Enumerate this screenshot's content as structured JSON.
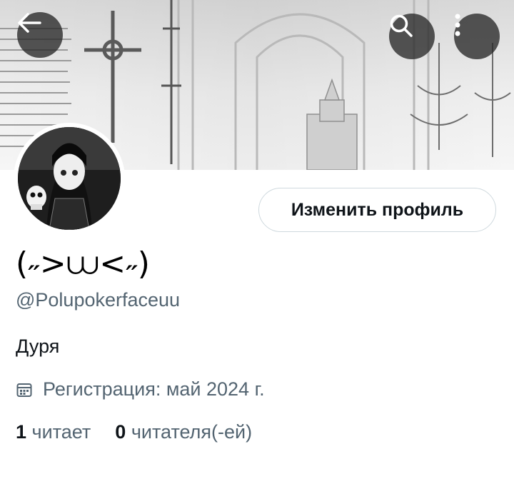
{
  "banner": {
    "description_colors": {
      "tone": "#e6e6e6"
    }
  },
  "toolbar": {
    "back_icon": "arrow-left-icon",
    "search_icon": "search-icon",
    "more_icon": "more-vertical-icon"
  },
  "profile": {
    "display_name": "(˶>⩊<˶)",
    "handle": "@Polupokerfaceuu",
    "bio": "Дуря",
    "joined_label": "Регистрация: май 2024 г.",
    "edit_button_label": "Изменить профиль",
    "following_count": "1",
    "following_label": "читает",
    "followers_count": "0",
    "followers_label": "читателя(-ей)"
  },
  "colors": {
    "muted": "#536471",
    "text": "#0f1419",
    "border": "#cfd9de"
  }
}
